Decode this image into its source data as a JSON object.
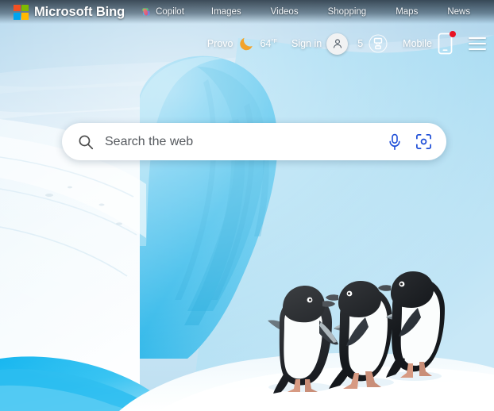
{
  "brand": {
    "name": "Microsoft Bing",
    "logo_colors": [
      "#f25022",
      "#7fba00",
      "#00a4ef",
      "#ffb900"
    ],
    "logo_icon": "microsoft-squares-icon"
  },
  "nav": {
    "items": [
      {
        "label": "Copilot",
        "icon": "copilot-icon"
      },
      {
        "label": "Images",
        "icon": ""
      },
      {
        "label": "Videos",
        "icon": ""
      },
      {
        "label": "Shopping",
        "icon": ""
      },
      {
        "label": "Maps",
        "icon": ""
      },
      {
        "label": "News",
        "icon": ""
      }
    ]
  },
  "utility": {
    "location": "Provo",
    "weather_icon": "crescent-moon-icon",
    "weather_icon_color": "#f0a830",
    "temperature": "64",
    "temperature_unit": "°F",
    "sign_in": "Sign in",
    "avatar_icon": "person-avatar-icon",
    "rewards_count": "5",
    "rewards_icon": "rewards-medal-icon",
    "mobile_label": "Mobile",
    "mobile_icon": "phone-icon",
    "notification_badge_color": "#e81123",
    "menu_icon": "hamburger-menu-icon"
  },
  "search": {
    "placeholder": "Search the web",
    "value": "",
    "search_icon": "magnifier-icon",
    "mic_icon": "microphone-icon",
    "visual_search_icon": "visual-search-camera-icon",
    "accent_color": "#1f4fd8"
  },
  "background": {
    "description": "Adelie penguins walking on a blue iceberg in Antarctica",
    "sky_color": "#a8d4ee",
    "ice_color": "#2bb6ea",
    "snow_color": "#f4fafd",
    "penguin_count": 3
  }
}
